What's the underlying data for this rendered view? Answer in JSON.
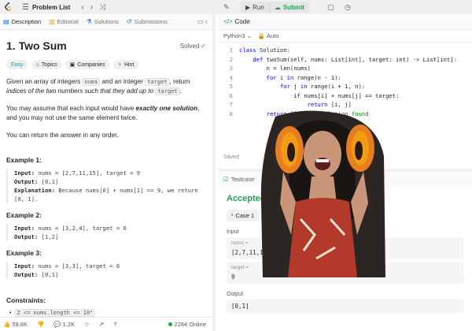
{
  "topbar": {
    "problem_list_label": "Problem List",
    "run_label": "Run",
    "submit_label": "Submit"
  },
  "left": {
    "tabs": {
      "description": "Description",
      "editorial": "Editorial",
      "solutions": "Solutions",
      "submissions": "Submissions"
    },
    "title": "1. Two Sum",
    "status": "Solved",
    "chips": {
      "difficulty": "Easy",
      "topics": "Topics",
      "companies": "Companies",
      "hint": "Hint"
    },
    "para1": {
      "a": "Given an array of integers ",
      "code1": "nums",
      "b": " and an integer ",
      "code2": "target",
      "c": ", return ",
      "em1": "indices of the two numbers such that they add up to",
      "d": " ",
      "code3": "target",
      "e": "."
    },
    "para2": {
      "a": "You may assume that each input would have ",
      "em": "exactly one solution",
      "b": ", and you may not use the same element twice."
    },
    "para3": "You can return the answer in any order.",
    "examples": [
      {
        "title": "Example 1:",
        "input_label": "Input:",
        "input": "nums = [2,7,11,15], target = 9",
        "output_label": "Output:",
        "output": "[0,1]",
        "explanation_label": "Explanation:",
        "explanation": "Because nums[0] + nums[1] == 9, we return [0, 1]."
      },
      {
        "title": "Example 2:",
        "input_label": "Input:",
        "input": "nums = [3,2,4], target = 6",
        "output_label": "Output:",
        "output": "[1,2]"
      },
      {
        "title": "Example 3:",
        "input_label": "Input:",
        "input": "nums = [3,3], target = 6",
        "output_label": "Output:",
        "output": "[0,1]"
      }
    ],
    "constraints_title": "Constraints:",
    "constraint1": "2 <= nums.length <= 10⁴",
    "bottom": {
      "likes": "59.8K",
      "comments": "1.2K",
      "online": "2284 Online"
    }
  },
  "right": {
    "code_tab": "Code",
    "language": "Python3",
    "autosave": "Auto",
    "code_lines": [
      {
        "n": "1",
        "text": "class Solution:"
      },
      {
        "n": "2",
        "text": "    def twoSum(self, nums: List[int], target: int) -> List[int]:"
      },
      {
        "n": "3",
        "text": "        n = len(nums)"
      },
      {
        "n": "4",
        "text": "        for i in range(n - 1):"
      },
      {
        "n": "5",
        "text": "            for j in range(i + 1, n):"
      },
      {
        "n": "6",
        "text": "                if nums[i] + nums[j] == target:"
      },
      {
        "n": "7",
        "text": "                    return [i, j]"
      },
      {
        "n": "8",
        "text": "        return []  # No solution found"
      }
    ],
    "saved": "Saved",
    "testcase_tab": "Testcase",
    "result": "Accepted",
    "case_label": "Case 1",
    "input_label": "Input",
    "nums_label": "nums =",
    "nums_value": "[2,7,11,15]",
    "target_label": "target =",
    "target_value": "9",
    "output_label": "Output",
    "output_value": "[0,1]"
  },
  "colors": {
    "accepted": "#1fa64b",
    "easy": "#00af9b",
    "keyword": "#0000ff"
  }
}
